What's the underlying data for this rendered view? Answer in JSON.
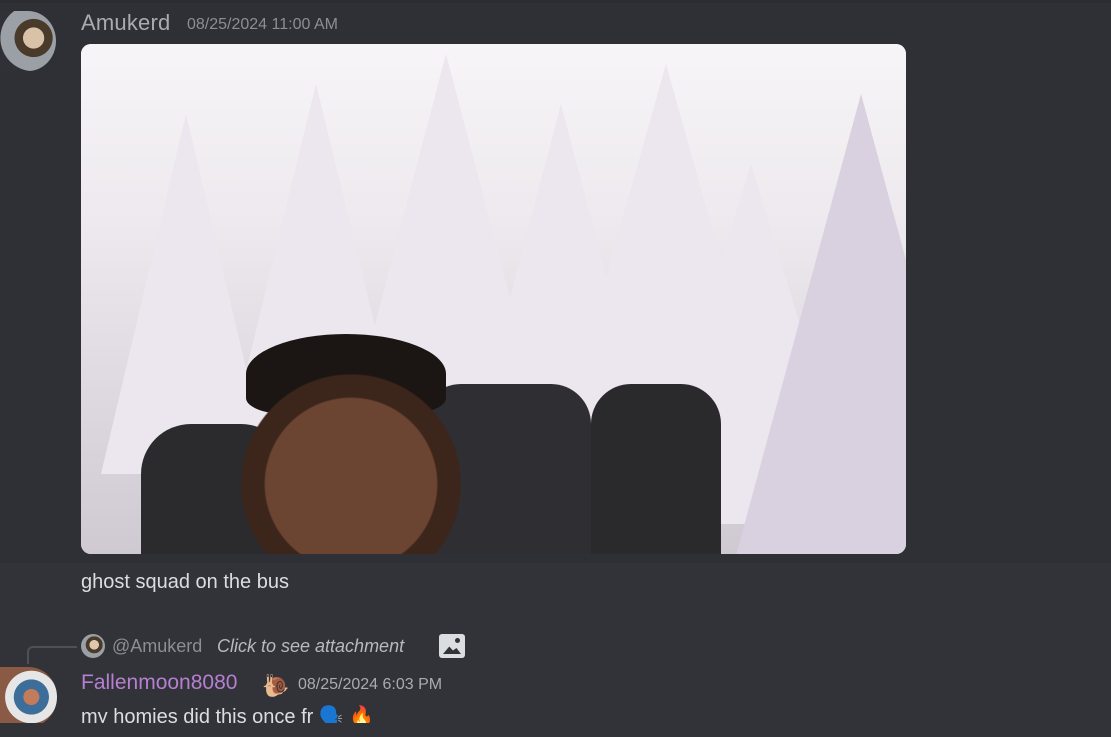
{
  "messages": [
    {
      "author": "Amukerd",
      "timestamp": "08/25/2024 11:00 AM",
      "text": "ghost squad on the bus",
      "attachment_icon": "image-attachment"
    },
    {
      "author": "Fallenmoon8080",
      "author_badge": "🐌",
      "timestamp": "08/25/2024 6:03 PM",
      "text": "my homies did this once fr",
      "emoji": [
        "🗣️",
        "🔥"
      ],
      "reply": {
        "author": "@Amukerd",
        "preview": "Click to see attachment",
        "icon": "image-icon"
      }
    }
  ],
  "colors": {
    "background": "#313338",
    "author1": "#a9abb0",
    "author2": "#b67fd1",
    "timestamp": "#8b8e94",
    "text": "#dbdee1"
  }
}
